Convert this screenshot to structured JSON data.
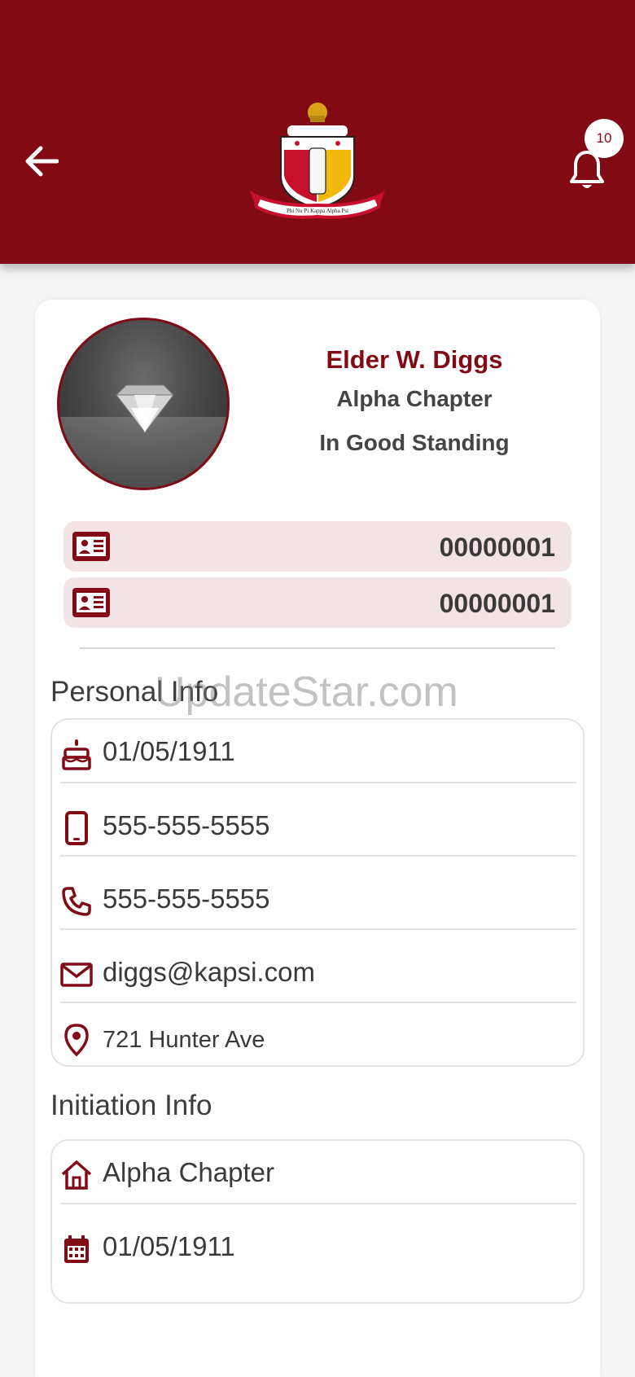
{
  "header": {
    "notification_count": "10",
    "colors": {
      "primary": "#820a15",
      "card_bg": "#ffffff",
      "id_row_bg": "#f2e4e5"
    },
    "logo_caption": "Phi Nu Pi Kappa Alpha Psi"
  },
  "profile": {
    "name": "Elder W. Diggs",
    "chapter": "Alpha Chapter",
    "status": "In Good Standing",
    "ids": [
      "00000001",
      "00000001"
    ]
  },
  "watermark": "UpdateStar.com",
  "personal_info": {
    "title": "Personal Info",
    "birthday": "01/05/1911",
    "mobile": "555-555-5555",
    "phone": "555-555-5555",
    "email": "diggs@kapsi.com",
    "address": "721 Hunter Ave"
  },
  "initiation_info": {
    "title": "Initiation Info",
    "chapter": "Alpha Chapter",
    "date": "01/05/1911"
  }
}
